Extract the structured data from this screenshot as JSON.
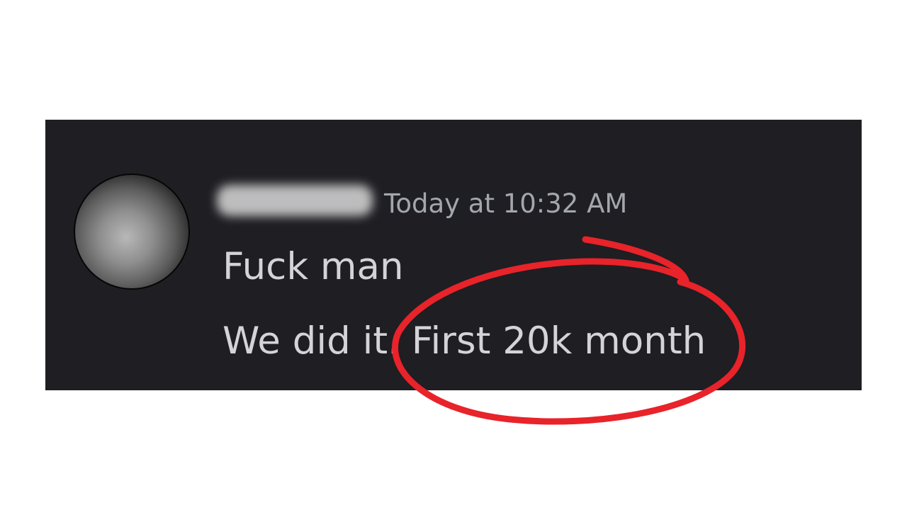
{
  "message": {
    "timestamp": "Today at 10:32 AM",
    "lines": [
      "Fuck man",
      "We did it. First 20k month"
    ]
  },
  "colors": {
    "card_background": "#1e1e23",
    "timestamp_text": "#a3a6ad",
    "message_text": "#d4d4d8",
    "annotation_red": "#e8232a"
  }
}
